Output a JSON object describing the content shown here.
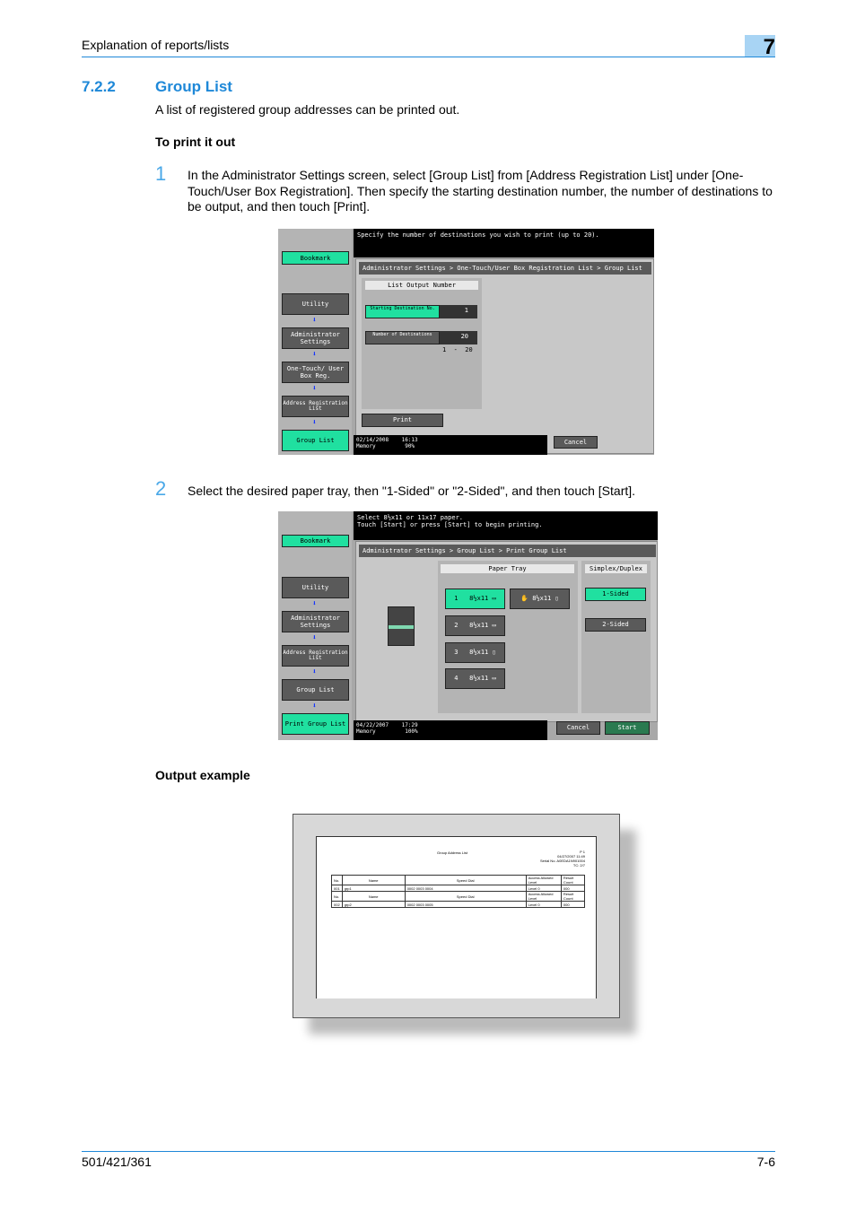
{
  "header": {
    "title": "Explanation of reports/lists",
    "chapter": "7"
  },
  "section": {
    "number": "7.2.2",
    "title": "Group List",
    "intro": "A list of registered group addresses can be printed out.",
    "subhead": "To print it out"
  },
  "steps": [
    {
      "num": "1",
      "text": "In the Administrator Settings screen, select [Group List] from [Address Registration List] under [One-Touch/User Box Registration]. Then specify the starting destination number, the number of destinations to be output, and then touch [Print]."
    },
    {
      "num": "2",
      "text": "Select the desired paper tray, then \"1-Sided\" or \"2-Sided\", and then touch [Start]."
    }
  ],
  "screen1": {
    "message": "Specify the number of destinations you wish to print (up to 20).",
    "bookmark": "Bookmark",
    "side": [
      "Utility",
      "Administrator Settings",
      "One-Touch/ User Box Reg.",
      "Address Registration List",
      "Group List"
    ],
    "breadcrumb": "Administrator Settings > One-Touch/User Box Registration List > Group List",
    "panel_title": "List Output Number",
    "start_label": "Starting Destination No.",
    "start_value": "1",
    "count_label": "Number of Destinations",
    "count_value": "20",
    "range": "1  -  20",
    "print": "Print",
    "cancel": "Cancel",
    "date": "02/14/2008",
    "time": "16:13",
    "memory_label": "Memory",
    "memory": "90%"
  },
  "screen2": {
    "message1": "Select 8½x11 or 11x17 paper.",
    "message2": "Touch [Start] or press [Start] to begin printing.",
    "bookmark": "Bookmark",
    "side": [
      "Utility",
      "Administrator Settings",
      "Address Registration List",
      "Group List",
      "Print Group List"
    ],
    "breadcrumb": "Administrator Settings > Group List > Print Group List",
    "paper_tray": "Paper Tray",
    "simplex": "Simplex/Duplex",
    "trays": [
      {
        "n": "1",
        "size": "8½x11 ▭"
      },
      {
        "n": "2",
        "size": "8½x11 ▭"
      },
      {
        "n": "3",
        "size": "8½x11 ▯"
      },
      {
        "n": "4",
        "size": "8½x11 ▭"
      }
    ],
    "bypass": "8½x11 ▯",
    "one_sided": "1-Sided",
    "two_sided": "2-Sided",
    "cancel": "Cancel",
    "start": "Start",
    "date": "04/22/2007",
    "time": "17:29",
    "memory_label": "Memory",
    "memory": "100%"
  },
  "output": {
    "heading": "Output example",
    "title": "Group Address List",
    "page": "P  1",
    "datetime": "04/27/2007 11:49",
    "serial": "Serial No.  A0EDA1N901004",
    "tc": "TC:   2/7",
    "cols": [
      "No.",
      "Name",
      "Speed Dial",
      "Access Allowed Level",
      "Result Count"
    ],
    "rows": [
      [
        "001",
        "grp1",
        "0002 0003 0004",
        "Level 0",
        "000"
      ],
      [
        "002",
        "grp2",
        "0002 0003 0005",
        "Level 0",
        "000"
      ]
    ]
  },
  "footer": {
    "model": "501/421/361",
    "page": "7-6"
  },
  "colors": {
    "accent": "#1e88d8",
    "button_active": "#20e0a0"
  }
}
